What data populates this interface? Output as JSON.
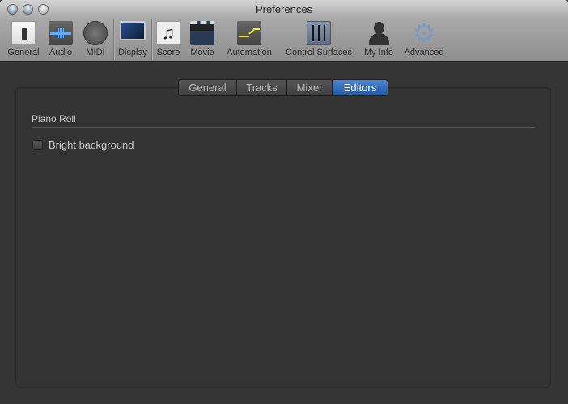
{
  "window": {
    "title": "Preferences"
  },
  "toolbar": [
    {
      "label": "General",
      "icon": "switch-icon"
    },
    {
      "label": "Audio",
      "icon": "waveform-icon"
    },
    {
      "label": "MIDI",
      "icon": "midi-connector-icon"
    },
    {
      "label": "Display",
      "icon": "monitor-icon"
    },
    {
      "label": "Score",
      "icon": "music-notes-icon"
    },
    {
      "label": "Movie",
      "icon": "clapperboard-icon"
    },
    {
      "label": "Automation",
      "icon": "automation-curve-icon"
    },
    {
      "label": "Control Surfaces",
      "icon": "faders-icon"
    },
    {
      "label": "My Info",
      "icon": "person-icon"
    },
    {
      "label": "Advanced",
      "icon": "gear-icon"
    }
  ],
  "tabs": [
    {
      "label": "General"
    },
    {
      "label": "Tracks"
    },
    {
      "label": "Mixer"
    },
    {
      "label": "Editors",
      "active": true
    }
  ],
  "section": {
    "title": "Piano Roll",
    "options": [
      {
        "label": "Bright background",
        "checked": false
      }
    ]
  },
  "colors": {
    "accent": "#2a6bbf",
    "background": "#353535"
  }
}
